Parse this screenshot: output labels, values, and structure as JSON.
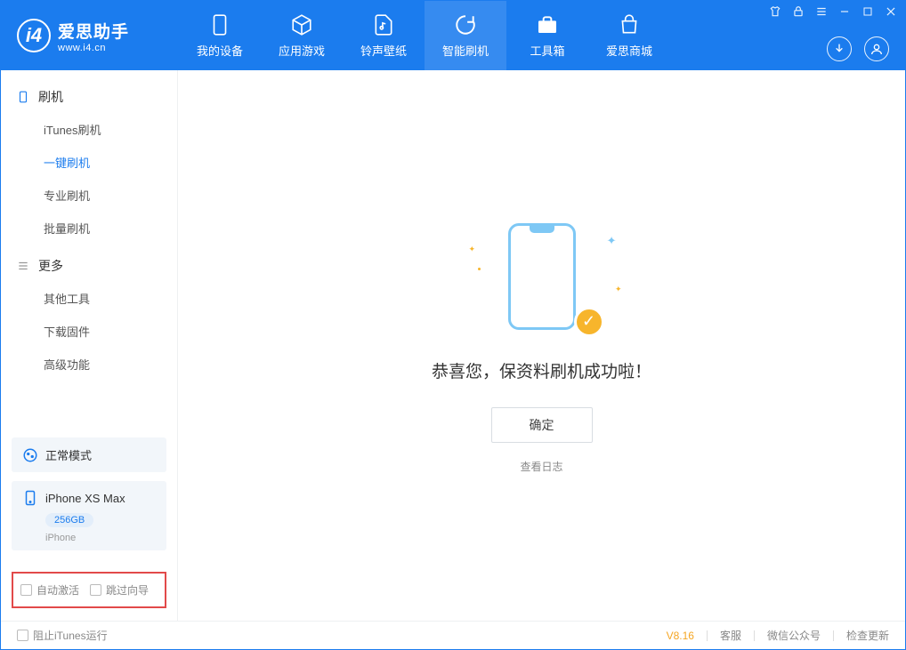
{
  "app": {
    "title": "爱思助手",
    "subtitle": "www.i4.cn"
  },
  "tabs": [
    {
      "label": "我的设备"
    },
    {
      "label": "应用游戏"
    },
    {
      "label": "铃声壁纸"
    },
    {
      "label": "智能刷机"
    },
    {
      "label": "工具箱"
    },
    {
      "label": "爱思商城"
    }
  ],
  "sidebar": {
    "group_flash": "刷机",
    "items_flash": [
      {
        "label": "iTunes刷机"
      },
      {
        "label": "一键刷机"
      },
      {
        "label": "专业刷机"
      },
      {
        "label": "批量刷机"
      }
    ],
    "group_more": "更多",
    "items_more": [
      {
        "label": "其他工具"
      },
      {
        "label": "下载固件"
      },
      {
        "label": "高级功能"
      }
    ]
  },
  "status": {
    "mode": "正常模式",
    "device_name": "iPhone XS Max",
    "storage": "256GB",
    "device_type": "iPhone"
  },
  "checks": {
    "auto_activate": "自动激活",
    "skip_guide": "跳过向导"
  },
  "main": {
    "success_title": "恭喜您，保资料刷机成功啦！",
    "confirm": "确定",
    "view_log": "查看日志"
  },
  "footer": {
    "block_itunes": "阻止iTunes运行",
    "version": "V8.16",
    "support": "客服",
    "wechat": "微信公众号",
    "check_update": "检查更新"
  }
}
